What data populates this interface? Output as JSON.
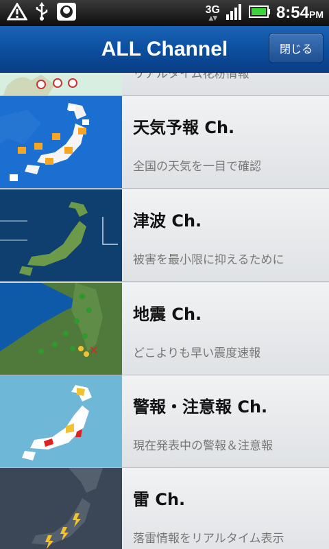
{
  "status_bar": {
    "icons": [
      "warning-icon",
      "usb-icon",
      "app-notification-icon"
    ],
    "network": "3G",
    "time": "8:54",
    "ampm": "PM"
  },
  "header": {
    "title": "ALL Channel",
    "close_label": "閉じる"
  },
  "channels": [
    {
      "title": "",
      "subtitle": "リアルタイム花粉情報",
      "thumb": "pollen-map"
    },
    {
      "title": "天気予報 Ch.",
      "subtitle": "全国の天気を一目で確認",
      "thumb": "weather-map"
    },
    {
      "title": "津波 Ch.",
      "subtitle": "被害を最小限に抑えるために",
      "thumb": "tsunami-map"
    },
    {
      "title": "地震 Ch.",
      "subtitle": "どこよりも早い震度速報",
      "thumb": "earthquake-map"
    },
    {
      "title": "警報・注意報 Ch.",
      "subtitle": "現在発表中の警報＆注意報",
      "thumb": "warning-map"
    },
    {
      "title": "雷 Ch.",
      "subtitle": "落雷情報をリアルタイム表示",
      "thumb": "lightning-map"
    }
  ],
  "colors": {
    "title_bar": "#0c4f9f",
    "list_bg": "#e4e7ea",
    "weather_bg": "#1a6fd0",
    "tsunami_bg": "#0f3f6e",
    "quake_bg": "#0f5aa8",
    "warning_bg": "#6fb7d6",
    "lightning_bg": "#3b4656"
  }
}
